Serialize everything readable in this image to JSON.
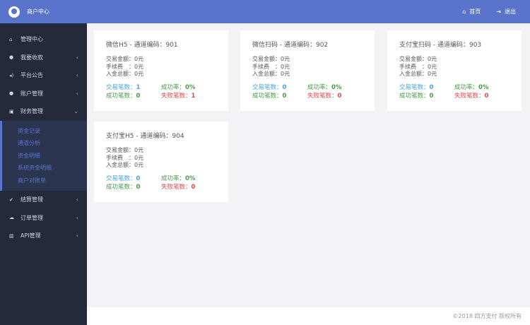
{
  "header": {
    "title": "商户中心",
    "home": "首页",
    "logout": "退出"
  },
  "sidebar": {
    "items": [
      {
        "label": "管理中心",
        "icon": "home-icon",
        "chev": ""
      },
      {
        "label": "我要收款",
        "icon": "user-icon",
        "chev": "‹"
      },
      {
        "label": "平台公告",
        "icon": "volume-icon",
        "chev": "‹"
      },
      {
        "label": "账户管理",
        "icon": "user-icon",
        "chev": "‹"
      },
      {
        "label": "财务管理",
        "icon": "money-icon",
        "chev": "⌄"
      }
    ],
    "sub": [
      "资金记录",
      "通道分析",
      "资金明细",
      "系统资金明细",
      "商户对账单"
    ],
    "items2": [
      {
        "label": "结算管理",
        "icon": "check-icon",
        "chev": "‹"
      },
      {
        "label": "订单管理",
        "icon": "cloud-icon",
        "chev": "‹"
      },
      {
        "label": "API管理",
        "icon": "bank-icon",
        "chev": "‹"
      }
    ]
  },
  "labels": {
    "amount": "交易金额：",
    "fee": "手续费　：",
    "total": "入金总额：",
    "count": "交易笔数：",
    "rate": "成功率：",
    "success": "成功笔数：",
    "fail": "失败笔数："
  },
  "cards": [
    {
      "title": "微信H5 - 通道编码：901",
      "amount": "0元",
      "fee": "0元",
      "total": "0元",
      "count": "1",
      "rate": "0%",
      "success": "0",
      "fail": "1"
    },
    {
      "title": "微信扫码 - 通道编码：902",
      "amount": "0元",
      "fee": "0元",
      "total": "0元",
      "count": "0",
      "rate": "0%",
      "success": "0",
      "fail": "0"
    },
    {
      "title": "支付宝扫码 - 通道编码：903",
      "amount": "0元",
      "fee": "0元",
      "total": "0元",
      "count": "0",
      "rate": "0%",
      "success": "0",
      "fail": "0"
    },
    {
      "title": "支付宝H5 - 通道编码：904",
      "amount": "0元",
      "fee": "0元",
      "total": "0元",
      "count": "0",
      "rate": "0%",
      "success": "0",
      "fail": "0"
    }
  ],
  "footer": "©2018 四方支付 版权所有",
  "colors": {
    "header": "#5a74cc",
    "sidebar": "#242a3a",
    "blue": "#4aa3df",
    "green": "#4a9a4a",
    "red": "#e04a4a"
  }
}
